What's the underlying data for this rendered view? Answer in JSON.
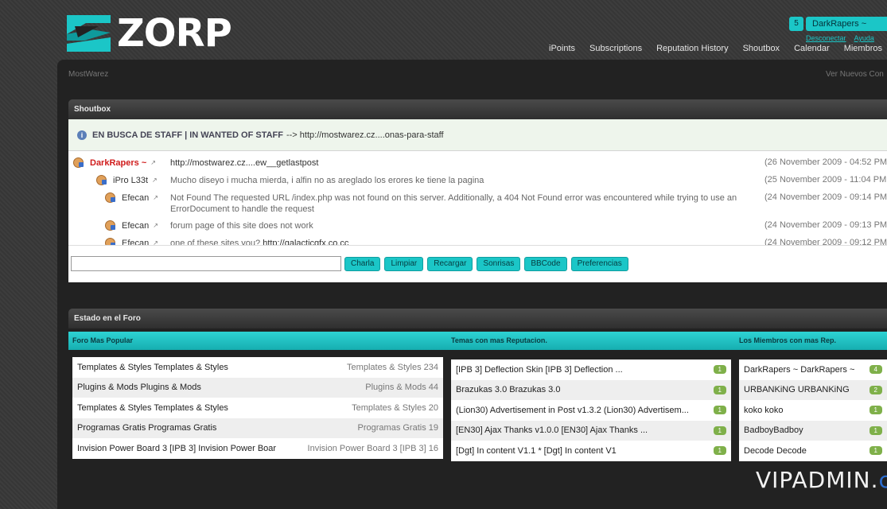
{
  "brand": {
    "logo_text": "ZORP"
  },
  "user": {
    "notifications": "5",
    "name": "DarkRapers ~",
    "links": [
      "Desconectar",
      "Ayuda"
    ]
  },
  "nav": [
    "iPoints",
    "Subscriptions",
    "Reputation History",
    "Shoutbox",
    "Calendar",
    "Miembros"
  ],
  "breadcrumb": {
    "left": "MostWarez",
    "right": "Ver Nuevos Con"
  },
  "shoutbox": {
    "title": "Shoutbox",
    "announcement_bold": "EN BUSCA DE STAFF | IN WANTED OF STAFF",
    "announcement_rest": "--> http://mostwarez.cz....onas-para-staff",
    "messages": [
      {
        "name": "DarkRapers ~",
        "text": "http://mostwarez.cz....ew__getlastpost",
        "date": "(26 November 2009 - 04:52 PM"
      },
      {
        "name": "iPro L33t",
        "text": "Mucho diseyo i mucha mierda, i alfin no as areglado los erores ke tiene la pagina",
        "date": "(25 November 2009 - 11:04 PM"
      },
      {
        "name": "Efecan",
        "text": "Not Found The requested URL /index.php was not found on this server. Additionally, a 404 Not Found error was encountered while trying to use an ErrorDocument to handle the request",
        "date": "(24 November 2009 - 09:14 PM"
      },
      {
        "name": "Efecan",
        "text": "forum page of this site does not work",
        "date": "(24 November 2009 - 09:13 PM"
      },
      {
        "name": "Efecan",
        "text": "one of these sites you?",
        "link": "http://galacticgfx.co.cc",
        "date": "(24 November 2009 - 09:12 PM"
      }
    ],
    "buttons": [
      "Charla",
      "Limpiar",
      "Recargar",
      "Sonrisas",
      "BBCode",
      "Preferencias"
    ]
  },
  "estado": {
    "title": "Estado en el Foro",
    "tabs": [
      "Foro Mas Popular",
      "Temas con mas Reputacion.",
      "Los Miembros con mas Rep."
    ],
    "popular": [
      {
        "left": "Templates & Styles Templates & Styles",
        "right": "Templates & Styles 234"
      },
      {
        "left": "Plugins & Mods Plugins & Mods",
        "right": "Plugins & Mods 44"
      },
      {
        "left": "Templates & Styles Templates & Styles",
        "right": "Templates & Styles 20"
      },
      {
        "left": "Programas Gratis Programas Gratis",
        "right": "Programas Gratis 19"
      },
      {
        "left": "Invision Power Board 3 [IPB 3] Invision Power Boar",
        "right": "Invision Power Board 3 [IPB 3] 16"
      }
    ],
    "topics": [
      {
        "left": "[IPB 3] Deflection Skin [IPB 3] Deflection ...",
        "count": "1"
      },
      {
        "left": "Brazukas 3.0 Brazukas 3.0",
        "count": "1"
      },
      {
        "left": "(Lion30) Advertisement in Post v1.3.2 (Lion30) Advertisem...",
        "count": "1"
      },
      {
        "left": "[EN30] Ajax Thanks v1.0.0 [EN30] Ajax Thanks ...",
        "count": "1"
      },
      {
        "left": "[Dgt] In content V1.1 * [Dgt] In content V1",
        "count": "1"
      }
    ],
    "members": [
      {
        "left": "DarkRapers ~ DarkRapers ~",
        "count": "4"
      },
      {
        "left": "URBANKiNG URBANKiNG",
        "count": "2"
      },
      {
        "left": "koko koko",
        "count": "1"
      },
      {
        "left": "BadboyBadboy",
        "count": "1"
      },
      {
        "left": "Decode Decode",
        "count": "1"
      }
    ]
  },
  "watermark": {
    "text": "VIPADMIN.",
    "suffix": "club"
  }
}
